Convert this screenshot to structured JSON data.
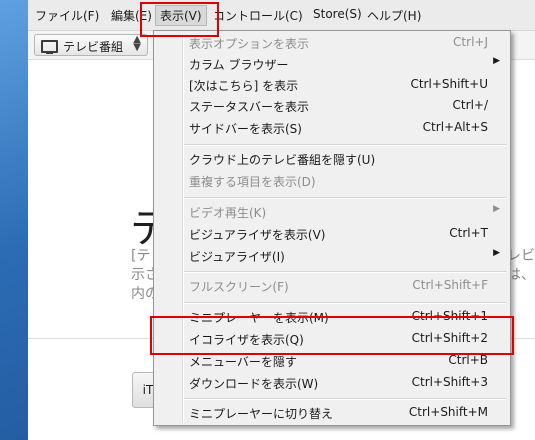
{
  "menubar": {
    "items": [
      {
        "label": "ファイル(F)"
      },
      {
        "label": "編集(E)"
      },
      {
        "label": "表示(V)"
      },
      {
        "label": "コントロール(C)"
      },
      {
        "label": "Store(S)"
      },
      {
        "label": "ヘルプ(H)"
      }
    ]
  },
  "toolbar": {
    "source_label": "テレビ番組"
  },
  "main": {
    "title_fragment": "テ",
    "desc_left": [
      "[テ",
      "示さ",
      "内の"
    ],
    "desc_right": [
      "レビ",
      "は、",
      ""
    ],
    "button_label": "iT"
  },
  "view_menu": {
    "items": [
      {
        "label": "表示オプションを表示",
        "shortcut": "Ctrl+J",
        "disabled": true
      },
      {
        "label": "カラム ブラウザー",
        "shortcut": "",
        "submenu": true
      },
      {
        "label": "[次はこちら] を表示",
        "shortcut": "Ctrl+Shift+U"
      },
      {
        "label": "ステータスバーを表示",
        "shortcut": "Ctrl+/"
      },
      {
        "label": "サイドバーを表示(S)",
        "shortcut": "Ctrl+Alt+S"
      },
      {
        "label": "クラウド上のテレビ番組を隠す(U)",
        "shortcut": ""
      },
      {
        "label": "重複する項目を表示(D)",
        "shortcut": "",
        "disabled": true
      },
      {
        "label": "ビデオ再生(K)",
        "shortcut": "",
        "disabled": true,
        "submenu": true
      },
      {
        "label": "ビジュアライザを表示(V)",
        "shortcut": "Ctrl+T"
      },
      {
        "label": "ビジュアライザ(I)",
        "shortcut": "",
        "submenu": true
      },
      {
        "label": "フルスクリーン(F)",
        "shortcut": "Ctrl+Shift+F",
        "disabled": true
      },
      {
        "label": "ミニプレーヤーを表示(M)",
        "shortcut": "Ctrl+Shift+1"
      },
      {
        "label": "イコライザを表示(Q)",
        "shortcut": "Ctrl+Shift+2"
      },
      {
        "label": "メニューバーを隠す",
        "shortcut": "Ctrl+B"
      },
      {
        "label": "ダウンロードを表示(W)",
        "shortcut": "Ctrl+Shift+3"
      },
      {
        "label": "ミニプレーヤーに切り替え",
        "shortcut": "Ctrl+Shift+M"
      }
    ]
  },
  "colors": {
    "highlight_box": "#e00000",
    "menu_bg": "#f0f0f0"
  }
}
